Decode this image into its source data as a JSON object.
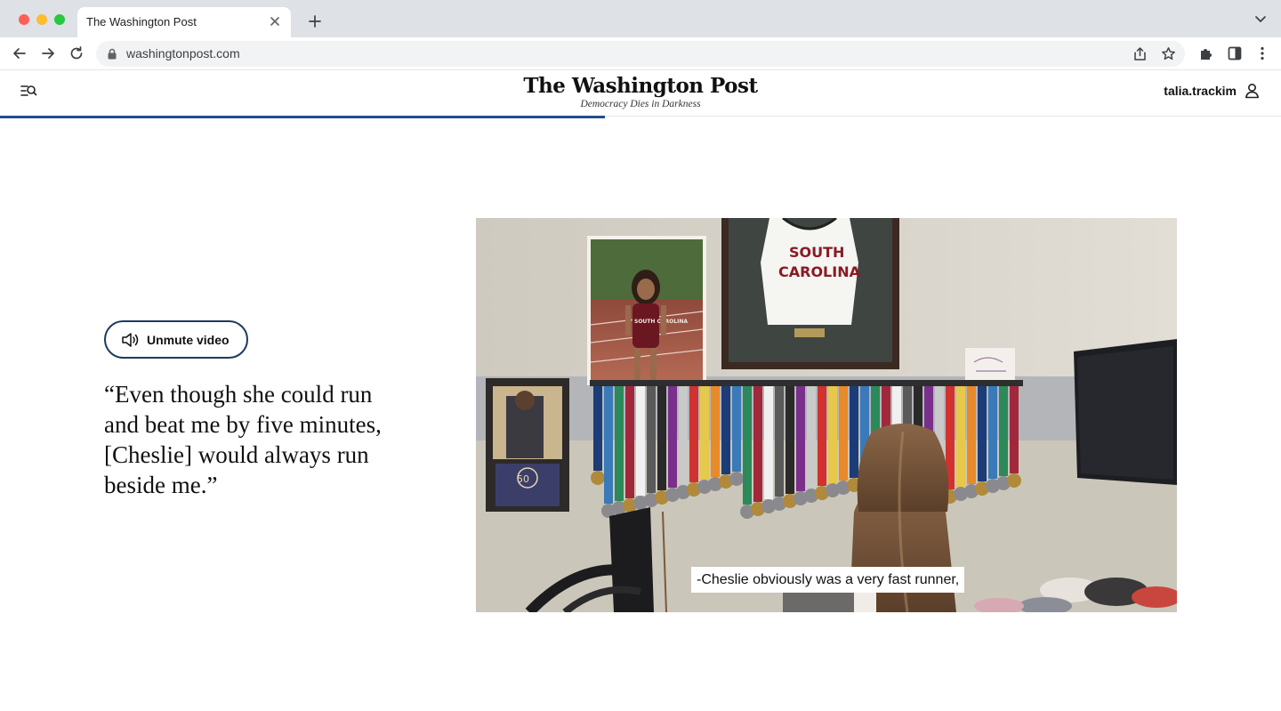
{
  "browser": {
    "tab_title": "The Washington Post",
    "url": "washingtonpost.com"
  },
  "site": {
    "masthead": "The Washington Post",
    "tagline": "Democracy Dies in Darkness",
    "username": "talia.trackim",
    "reading_progress_fraction": 0.472
  },
  "article": {
    "unmute_label": "Unmute video",
    "quote": "“Even though she could run and beat me by five minutes, [Cheslie] would always run beside me.”"
  },
  "video": {
    "jersey_line1": "SOUTH",
    "jersey_line2": "CAROLINA",
    "photo_singlet_text": "SOUTH CAROLINA",
    "frame_badge": "50",
    "caption": "-Cheslie obviously was a very fast runner,"
  },
  "colors": {
    "accent_navy": "#1d3b5c",
    "progress": "#1f4f8a",
    "jersey_text": "#8a1a22"
  }
}
